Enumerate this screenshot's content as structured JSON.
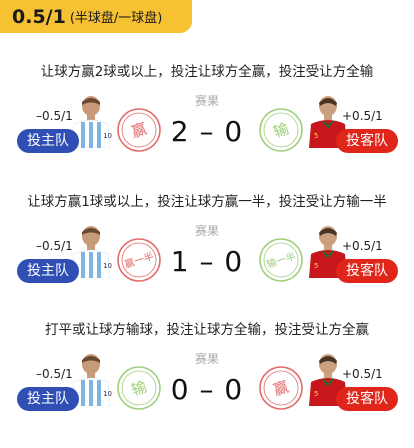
{
  "header": {
    "title": "0.5/1",
    "subtitle": "(半球盘/一球盘)"
  },
  "scenarios": [
    {
      "rule": "让球方赢2球或以上，投注让球方全赢，投注受让方全输",
      "home_handicap": "–0.5/1",
      "away_handicap": "+0.5/1",
      "home_label": "投主队",
      "away_label": "投客队",
      "result_label": "赛果",
      "score": "2 – 0",
      "home_stamp": "赢",
      "away_stamp": "输"
    },
    {
      "rule": "让球方赢1球或以上，投注让球方赢一半，投注受让方输一半",
      "home_handicap": "–0.5/1",
      "away_handicap": "+0.5/1",
      "home_label": "投主队",
      "away_label": "投客队",
      "result_label": "赛果",
      "score": "1 – 0",
      "home_stamp": "赢一半",
      "away_stamp": "输一半"
    },
    {
      "rule": "打平或让球方输球，投注让球方全输，投注受让方全赢",
      "home_handicap": "–0.5/1",
      "away_handicap": "+0.5/1",
      "home_label": "投主队",
      "away_label": "投客队",
      "result_label": "赛果",
      "score": "0 – 0",
      "home_stamp": "输",
      "away_stamp": "赢"
    }
  ],
  "colors": {
    "win": "#e36a6a",
    "lose": "#9fcf7b",
    "home": "#2f4fb4",
    "away": "#e0251b",
    "tag": "#f6c233"
  }
}
